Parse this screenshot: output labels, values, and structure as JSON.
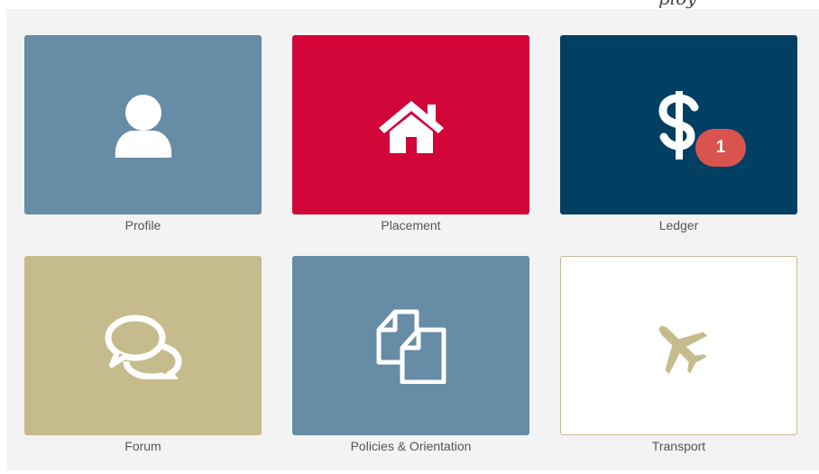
{
  "tiles": [
    {
      "label": "Profile",
      "icon": "user-icon",
      "color": "#678ca6"
    },
    {
      "label": "Placement",
      "icon": "home-icon",
      "color": "#d10537"
    },
    {
      "label": "Ledger",
      "icon": "dollar-icon",
      "color": "#013f63",
      "badge": "1"
    },
    {
      "label": "Forum",
      "icon": "chat-bubbles-icon",
      "color": "#c5bb8c"
    },
    {
      "label": "Policies & Orientation",
      "icon": "documents-icon",
      "color": "#678ca6"
    },
    {
      "label": "Transport",
      "icon": "airplane-icon",
      "color": "#ffffff"
    }
  ],
  "colors": {
    "badge": "#d9534f",
    "panel": "#f3f3f3",
    "label": "#555555"
  }
}
